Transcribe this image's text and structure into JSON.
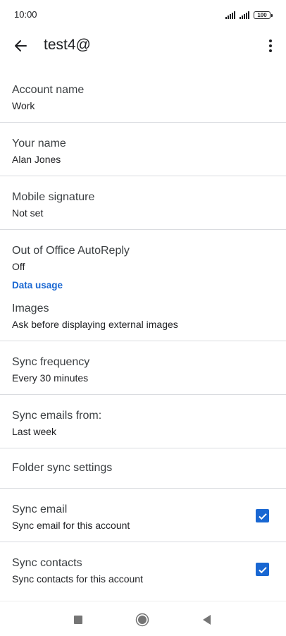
{
  "status_bar": {
    "time": "10:00",
    "battery": "100"
  },
  "app_bar": {
    "title": "test4@"
  },
  "settings": {
    "account_name": {
      "title": "Account name",
      "summary": "Work"
    },
    "your_name": {
      "title": "Your name",
      "summary": "Alan Jones"
    },
    "mobile_signature": {
      "title": "Mobile signature",
      "summary": "Not set"
    },
    "out_of_office": {
      "title": "Out of Office AutoReply",
      "summary": "Off"
    },
    "data_usage_header": "Data usage",
    "images": {
      "title": "Images",
      "summary": "Ask before displaying external images"
    },
    "sync_frequency": {
      "title": "Sync frequency",
      "summary": "Every 30 minutes"
    },
    "sync_emails_from": {
      "title": "Sync emails from:",
      "summary": "Last week"
    },
    "folder_sync": {
      "title": "Folder sync settings"
    },
    "sync_email": {
      "title": "Sync email",
      "summary": "Sync email for this account",
      "checked": true
    },
    "sync_contacts": {
      "title": "Sync contacts",
      "summary": "Sync contacts for this account",
      "checked": true
    }
  },
  "colors": {
    "accent": "#1967d2",
    "divider": "#dadce0",
    "text": "#202124"
  }
}
